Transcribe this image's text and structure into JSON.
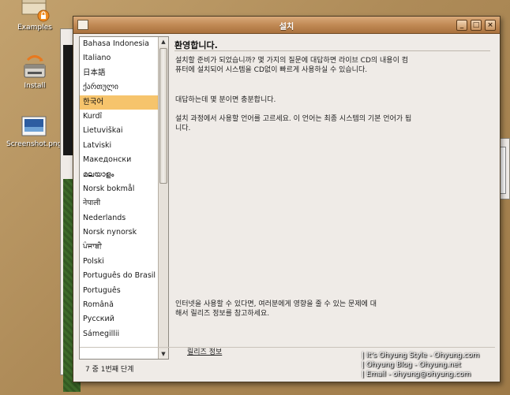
{
  "desktop": {
    "icons": [
      {
        "label": "Examples",
        "icon": "folder-lock-icon"
      },
      {
        "label": "Install",
        "icon": "installer-icon"
      },
      {
        "label": "Screenshot.png",
        "icon": "image-file-icon"
      }
    ]
  },
  "window": {
    "title": "설치",
    "buttons": {
      "minimize": "_",
      "maximize": "□",
      "close": "×"
    }
  },
  "languages": {
    "items": [
      "Bahasa Indonesia",
      "Italiano",
      "日本語",
      "ქართული",
      "한국어",
      "Kurdî",
      "Lietuviškai",
      "Latviski",
      "Македонски",
      "മലയാളം",
      "Norsk bokmål",
      "नेपाली",
      "Nederlands",
      "Norsk nynorsk",
      "ਪੰਜਾਬੀ",
      "Polski",
      "Português do Brasil",
      "Português",
      "Română",
      "Русский",
      "Sámegillii"
    ],
    "selected_index": 4,
    "scroll_up": "▲",
    "scroll_down": "▼"
  },
  "content": {
    "heading": "환영합니다.",
    "paragraphs": [
      "설치할 준비가 되었습니까? 몇 가지의 질문에 대답하면 라이브 CD의 내용이 컴퓨터에 설치되어 시스템을 CD없이 빠르게 사용하실 수 있습니다.",
      "대답하는데 몇 분이면 충분합니다.",
      "설치 과정에서 사용할 언어를 고르세요. 이 언어는 최종 시스템의 기본 언어가 됩니다."
    ],
    "internet_note": "인터넷을 사용할 수 있다면, 여러분에게 영향을 줄 수 있는 문제에 대해서 릴리즈 정보를 참고하세요.",
    "release_link": "릴리즈 정보"
  },
  "footer": {
    "step": "7 중 1번째 단계"
  },
  "watermark": [
    "| It's Ohyung Style - Ohyung.com",
    "| Ohyung Blog - Ohyung.net",
    "| Email - ohyung@ohyung.com"
  ]
}
